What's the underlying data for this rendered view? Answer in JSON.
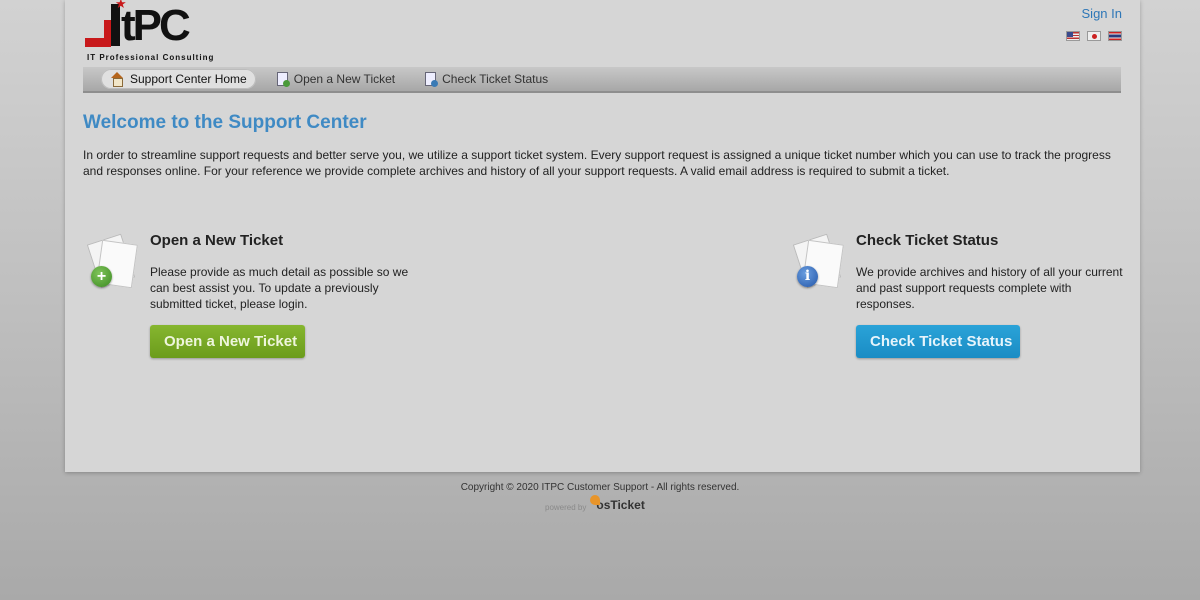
{
  "header": {
    "logo_text": "ITPC",
    "logo_subtitle": "IT Professional Consulting",
    "sign_in": "Sign In",
    "flags": [
      {
        "name": "us-flag-icon"
      },
      {
        "name": "japan-flag-icon"
      },
      {
        "name": "thailand-flag-icon"
      }
    ]
  },
  "nav": {
    "items": [
      {
        "label": "Support Center Home",
        "icon": "home-icon",
        "active": true
      },
      {
        "label": "Open a New Ticket",
        "icon": "new-ticket-icon",
        "active": false
      },
      {
        "label": "Check Ticket Status",
        "icon": "ticket-status-icon",
        "active": false
      }
    ]
  },
  "main": {
    "title": "Welcome to the Support Center",
    "intro": "In order to streamline support requests and better serve you, we utilize a support ticket system. Every support request is assigned a unique ticket number which you can use to track the progress and responses online. For your reference we provide complete archives and history of all your support requests. A valid email address is required to submit a ticket.",
    "open_ticket": {
      "title": "Open a New Ticket",
      "text": "Please provide as much detail as possible so we can best assist you. To update a previously submitted ticket, please login.",
      "button": "Open a New Ticket"
    },
    "check_status": {
      "title": "Check Ticket Status",
      "text": "We provide archives and history of all your current and past support requests complete with responses.",
      "button": "Check Ticket Status"
    }
  },
  "footer": {
    "copyright": "Copyright © 2020 ITPC Customer Support - All rights reserved.",
    "powered_by": "powered by",
    "brand": "osTicket"
  },
  "colors": {
    "accent_blue": "#3f8ac4",
    "button_green": "#7aa92a",
    "button_blue": "#2299d0",
    "logo_red": "#c8191b"
  }
}
